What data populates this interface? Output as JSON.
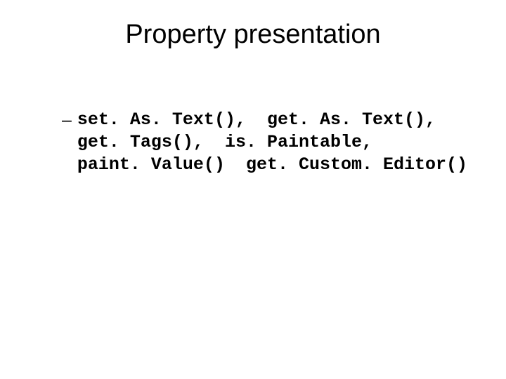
{
  "title": "Property presentation",
  "bullet": {
    "dash": "–",
    "line1": "set. As. Text(),  get. As. Text(),",
    "line2": "get. Tags(),  is. Paintable,",
    "line3": "paint. Value()  get. Custom. Editor()"
  }
}
